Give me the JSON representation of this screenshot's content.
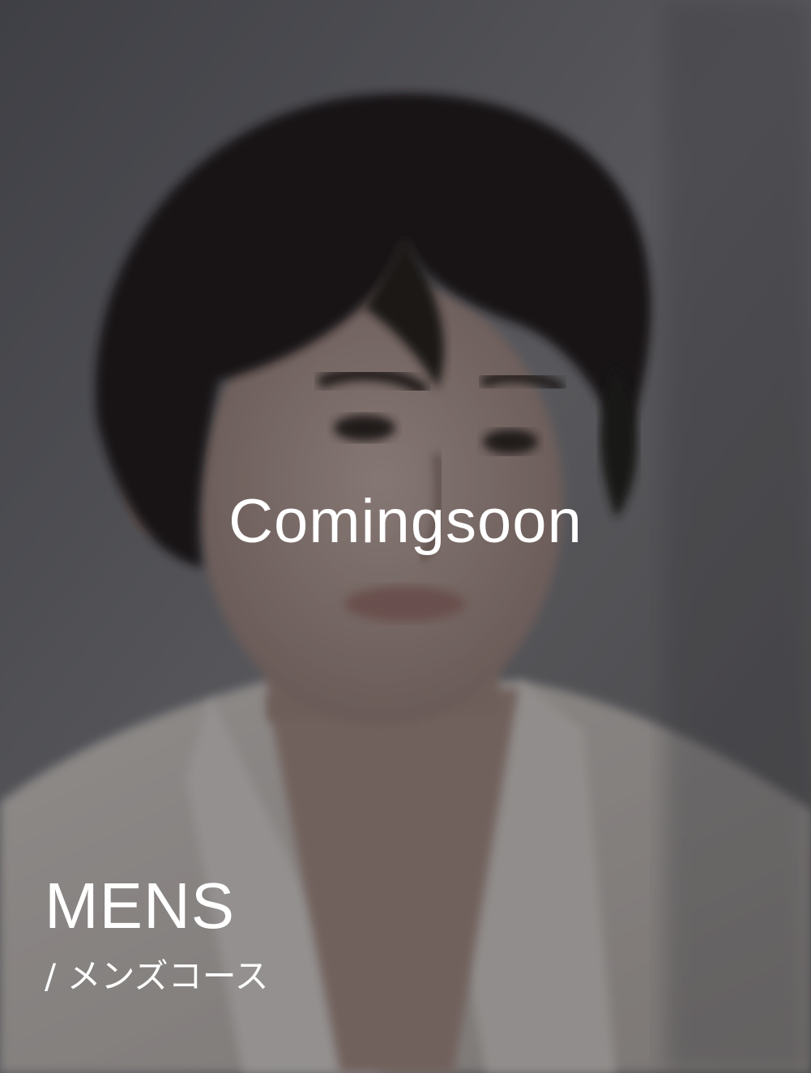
{
  "card": {
    "overlay_text": "Comingsoon",
    "title": "MENS",
    "subtitle": "/ メンズコース",
    "image_alt": "mens-model-photo"
  },
  "colors": {
    "overlay": "#141418",
    "text": "#ffffff",
    "background_wall": "#6b6b6e",
    "hair": "#1a1614",
    "skin": "#b39a90",
    "shirt": "#d6d0ca"
  }
}
